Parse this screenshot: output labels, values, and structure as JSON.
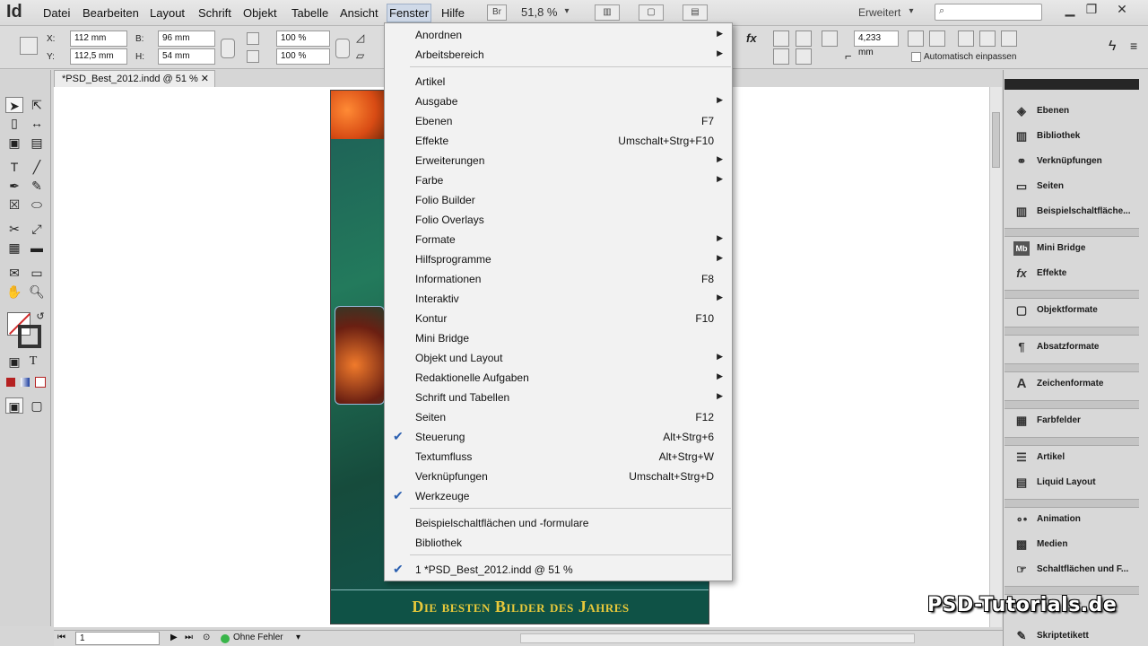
{
  "app": {
    "logo": "Id"
  },
  "menubar": {
    "items": [
      "Datei",
      "Bearbeiten",
      "Layout",
      "Schrift",
      "Objekt",
      "Tabelle",
      "Ansicht",
      "Fenster",
      "Hilfe"
    ],
    "bridge_button": "Br",
    "zoom": "51,8 %",
    "workspace": "Erweitert"
  },
  "control": {
    "x_label": "X:",
    "x_value": "112 mm",
    "y_label": "Y:",
    "y_value": "112,5 mm",
    "w_label": "B:",
    "w_value": "96 mm",
    "h_label": "H:",
    "h_value": "54 mm",
    "scale_x": "100 %",
    "scale_y": "100 %",
    "stroke_weight": "4,233 mm",
    "auto_fit": "Automatisch einpassen"
  },
  "document": {
    "tab_title": "*PSD_Best_2012.indd @ 51 %",
    "banner_text": "Die besten Bilder des Jahres"
  },
  "menu": {
    "items": [
      {
        "label": "Anordnen",
        "shortcut": "",
        "submenu": true,
        "checked": false
      },
      {
        "label": "Arbeitsbereich",
        "shortcut": "",
        "submenu": true,
        "checked": false
      },
      {
        "label": "Artikel",
        "shortcut": "",
        "submenu": false,
        "checked": false
      },
      {
        "label": "Ausgabe",
        "shortcut": "",
        "submenu": true,
        "checked": false
      },
      {
        "label": "Ebenen",
        "shortcut": "F7",
        "submenu": false,
        "checked": false
      },
      {
        "label": "Effekte",
        "shortcut": "Umschalt+Strg+F10",
        "submenu": false,
        "checked": false
      },
      {
        "label": "Erweiterungen",
        "shortcut": "",
        "submenu": true,
        "checked": false
      },
      {
        "label": "Farbe",
        "shortcut": "",
        "submenu": true,
        "checked": false
      },
      {
        "label": "Folio Builder",
        "shortcut": "",
        "submenu": false,
        "checked": false
      },
      {
        "label": "Folio Overlays",
        "shortcut": "",
        "submenu": false,
        "checked": false
      },
      {
        "label": "Formate",
        "shortcut": "",
        "submenu": true,
        "checked": false
      },
      {
        "label": "Hilfsprogramme",
        "shortcut": "",
        "submenu": true,
        "checked": false
      },
      {
        "label": "Informationen",
        "shortcut": "F8",
        "submenu": false,
        "checked": false
      },
      {
        "label": "Interaktiv",
        "shortcut": "",
        "submenu": true,
        "checked": false
      },
      {
        "label": "Kontur",
        "shortcut": "F10",
        "submenu": false,
        "checked": false
      },
      {
        "label": "Mini Bridge",
        "shortcut": "",
        "submenu": false,
        "checked": false
      },
      {
        "label": "Objekt und Layout",
        "shortcut": "",
        "submenu": true,
        "checked": false
      },
      {
        "label": "Redaktionelle Aufgaben",
        "shortcut": "",
        "submenu": true,
        "checked": false
      },
      {
        "label": "Schrift und Tabellen",
        "shortcut": "",
        "submenu": true,
        "checked": false
      },
      {
        "label": "Seiten",
        "shortcut": "F12",
        "submenu": false,
        "checked": false
      },
      {
        "label": "Steuerung",
        "shortcut": "Alt+Strg+6",
        "submenu": false,
        "checked": true
      },
      {
        "label": "Textumfluss",
        "shortcut": "Alt+Strg+W",
        "submenu": false,
        "checked": false
      },
      {
        "label": "Verknüpfungen",
        "shortcut": "Umschalt+Strg+D",
        "submenu": false,
        "checked": false
      },
      {
        "label": "Werkzeuge",
        "shortcut": "",
        "submenu": false,
        "checked": true
      },
      {
        "label": "Beispielschaltflächen und -formulare",
        "shortcut": "",
        "submenu": false,
        "checked": false
      },
      {
        "label": "Bibliothek",
        "shortcut": "",
        "submenu": false,
        "checked": false
      },
      {
        "label": "1 *PSD_Best_2012.indd @ 51 %",
        "shortcut": "",
        "submenu": false,
        "checked": true
      }
    ]
  },
  "panels": [
    {
      "label": "Ebenen",
      "icon": "layers-icon"
    },
    {
      "label": "Bibliothek",
      "icon": "library-icon"
    },
    {
      "label": "Verknüpfungen",
      "icon": "links-icon"
    },
    {
      "label": "Seiten",
      "icon": "pages-icon"
    },
    {
      "label": "Beispielschaltfläche...",
      "icon": "sample-buttons-icon"
    },
    {
      "label": "Mini Bridge",
      "icon": "mini-bridge-icon"
    },
    {
      "label": "Effekte",
      "icon": "effects-icon"
    },
    {
      "label": "Objektformate",
      "icon": "object-styles-icon"
    },
    {
      "label": "Absatzformate",
      "icon": "paragraph-styles-icon"
    },
    {
      "label": "Zeichenformate",
      "icon": "character-styles-icon"
    },
    {
      "label": "Farbfelder",
      "icon": "swatches-icon"
    },
    {
      "label": "Artikel",
      "icon": "articles-icon"
    },
    {
      "label": "Liquid Layout",
      "icon": "liquid-layout-icon"
    },
    {
      "label": "Animation",
      "icon": "animation-icon"
    },
    {
      "label": "Medien",
      "icon": "media-icon"
    },
    {
      "label": "Schaltflächen und F...",
      "icon": "buttons-forms-icon"
    },
    {
      "label": "Skriptetikett",
      "icon": "script-label-icon"
    }
  ],
  "status": {
    "page": "1",
    "preflight": "Ohne Fehler",
    "preflight_color": "#39b54a"
  },
  "watermark": "PSD-Tutorials.de"
}
